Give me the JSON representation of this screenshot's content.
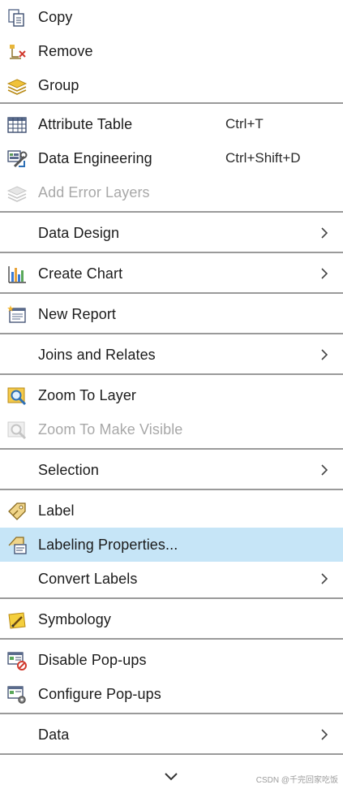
{
  "menu": {
    "items": [
      {
        "label": "Copy",
        "icon": "copy-icon"
      },
      {
        "label": "Remove",
        "icon": "remove-layer-icon"
      },
      {
        "label": "Group",
        "icon": "group-layers-icon"
      },
      {
        "label": "Attribute Table",
        "shortcut": "Ctrl+T",
        "icon": "attribute-table-icon"
      },
      {
        "label": "Data Engineering",
        "shortcut": "Ctrl+Shift+D",
        "icon": "data-engineering-icon"
      },
      {
        "label": "Add Error Layers",
        "icon": "error-layers-icon",
        "disabled": true
      },
      {
        "label": "Data Design",
        "submenu": true
      },
      {
        "label": "Create Chart",
        "icon": "chart-icon",
        "submenu": true
      },
      {
        "label": "New Report",
        "icon": "report-icon"
      },
      {
        "label": "Joins and Relates",
        "submenu": true
      },
      {
        "label": "Zoom To Layer",
        "icon": "zoom-layer-icon"
      },
      {
        "label": "Zoom To Make Visible",
        "icon": "zoom-visible-icon",
        "disabled": true
      },
      {
        "label": "Selection",
        "submenu": true
      },
      {
        "label": "Label",
        "icon": "label-icon"
      },
      {
        "label": "Labeling Properties...",
        "icon": "labeling-properties-icon",
        "highlighted": true
      },
      {
        "label": "Convert Labels",
        "submenu": true
      },
      {
        "label": "Symbology",
        "icon": "symbology-icon"
      },
      {
        "label": "Disable Pop-ups",
        "icon": "disable-popups-icon"
      },
      {
        "label": "Configure Pop-ups",
        "icon": "configure-popups-icon"
      },
      {
        "label": "Data",
        "submenu": true
      }
    ],
    "more_icon": "chevron-down-icon"
  },
  "watermark": "CSDN @千完回家吃饭",
  "colors": {
    "highlight": "#c6e5f7",
    "separator": "#9a9a9a",
    "disabled_text": "#a8a8a8"
  }
}
